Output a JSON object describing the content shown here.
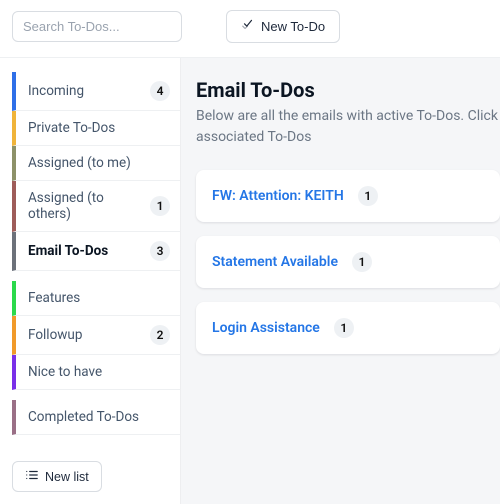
{
  "topbar": {
    "search_placeholder": "Search To-Dos...",
    "new_todo_label": "New To-Do"
  },
  "sidebar": {
    "groups": [
      {
        "items": [
          {
            "label": "Incoming",
            "count": 4,
            "color": "#2e6fe8"
          },
          {
            "label": "Private To-Dos",
            "count": null,
            "color": "#f0b43a"
          },
          {
            "label": "Assigned (to me)",
            "count": null,
            "color": "#8d9168"
          },
          {
            "label": "Assigned (to others)",
            "count": 1,
            "color": "#9e5c59"
          },
          {
            "label": "Email To-Dos",
            "count": 3,
            "color": "#6c717a",
            "active": true
          }
        ]
      },
      {
        "items": [
          {
            "label": "Features",
            "count": null,
            "color": "#2bd94b"
          },
          {
            "label": "Followup",
            "count": 2,
            "color": "#f19a2a"
          },
          {
            "label": "Nice to have",
            "count": null,
            "color": "#7a2fe8"
          }
        ]
      },
      {
        "items": [
          {
            "label": "Completed To-Dos",
            "count": null,
            "color": "#9a6f86"
          }
        ]
      }
    ],
    "new_list_label": "New list"
  },
  "main": {
    "title": "Email To-Dos",
    "description": "Below are all the emails with active To-Dos. Click associated To-Dos",
    "emails": [
      {
        "title": "FW: Attention: KEITH",
        "count": 1
      },
      {
        "title": "Statement Available",
        "count": 1
      },
      {
        "title": "Login Assistance",
        "count": 1
      }
    ]
  }
}
